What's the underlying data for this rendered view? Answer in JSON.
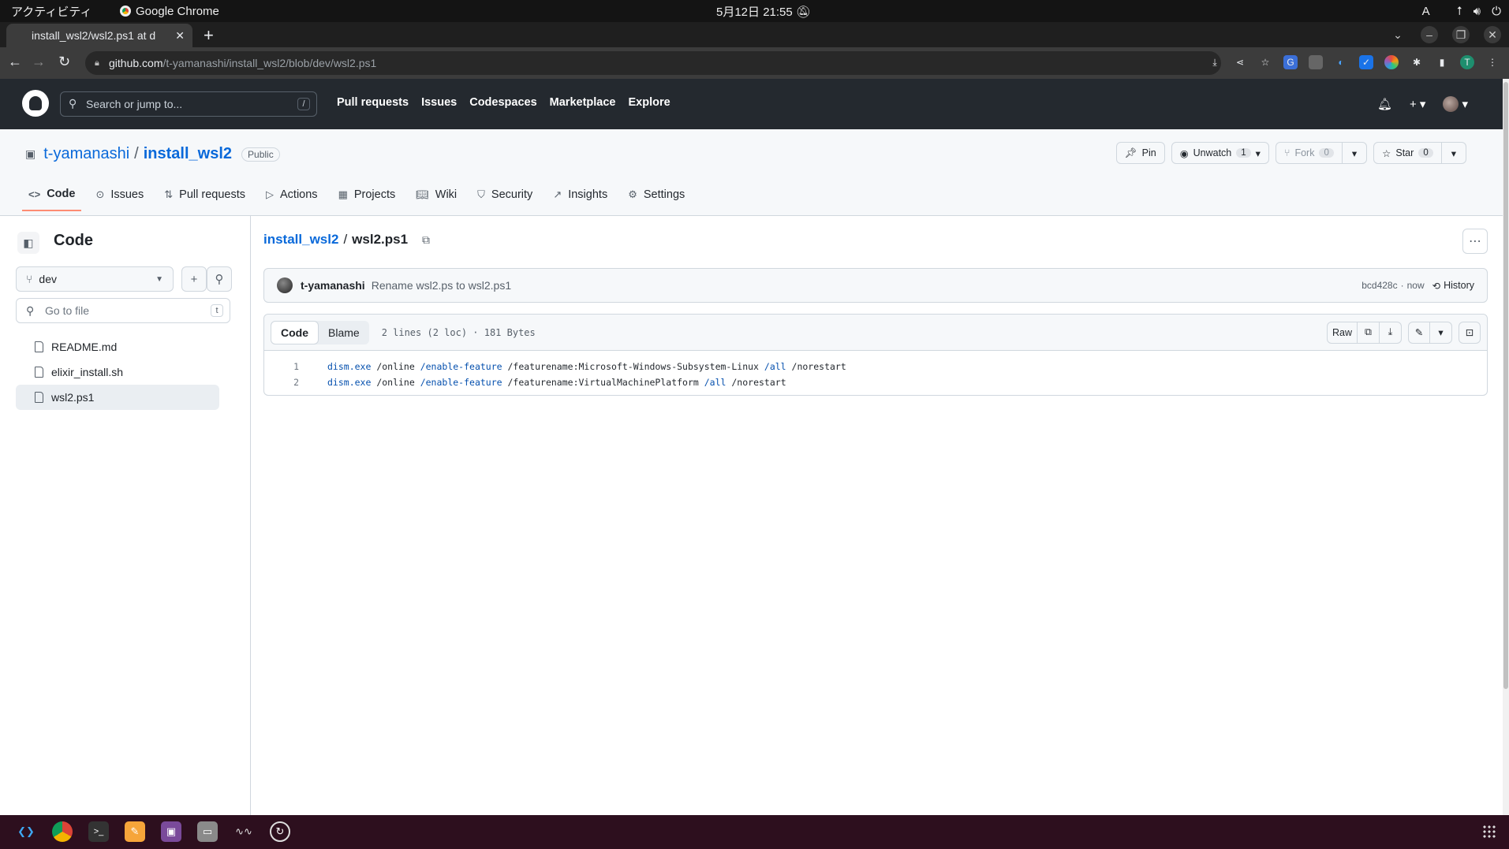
{
  "os": {
    "activities": "アクティビティ",
    "app_name": "Google Chrome",
    "clock": "5月12日  21:55",
    "input_method": "A"
  },
  "browser": {
    "tab_title": "install_wsl2/wsl2.ps1 at d",
    "url_host": "github.com",
    "url_path": "/t-yamanashi/install_wsl2/blob/dev/wsl2.ps1",
    "profile_initial": "T"
  },
  "github": {
    "search_placeholder": "Search or jump to...",
    "search_key": "/",
    "nav": [
      "Pull requests",
      "Issues",
      "Codespaces",
      "Marketplace",
      "Explore"
    ]
  },
  "repo": {
    "owner": "t-yamanashi",
    "name": "install_wsl2",
    "visibility": "Public",
    "pin_label": "Pin",
    "unwatch_label": "Unwatch",
    "unwatch_count": "1",
    "fork_label": "Fork",
    "fork_count": "0",
    "star_label": "Star",
    "star_count": "0",
    "tabs": [
      {
        "label": "Code",
        "icon": "code-icon"
      },
      {
        "label": "Issues",
        "icon": "issue-icon"
      },
      {
        "label": "Pull requests",
        "icon": "pull-request-icon"
      },
      {
        "label": "Actions",
        "icon": "play-icon"
      },
      {
        "label": "Projects",
        "icon": "table-icon"
      },
      {
        "label": "Wiki",
        "icon": "book-icon"
      },
      {
        "label": "Security",
        "icon": "shield-icon"
      },
      {
        "label": "Insights",
        "icon": "graph-icon"
      },
      {
        "label": "Settings",
        "icon": "gear-icon"
      }
    ]
  },
  "sidebar": {
    "title": "Code",
    "branch": "dev",
    "go_to_file_placeholder": "Go to file",
    "go_to_file_key": "t",
    "files": [
      "README.md",
      "elixir_install.sh",
      "wsl2.ps1"
    ]
  },
  "file": {
    "repo_crumb": "install_wsl2",
    "name": "wsl2.ps1",
    "commit_author": "t-yamanashi",
    "commit_message": "Rename wsl2.ps to wsl2.ps1",
    "commit_sha": "bcd428c",
    "commit_time": "now",
    "history_label": "History",
    "view_code": "Code",
    "view_blame": "Blame",
    "meta": "2 lines (2 loc) · 181 Bytes",
    "raw_label": "Raw",
    "lines": [
      {
        "num": "1",
        "cmd": "dism.exe",
        "a": " /online ",
        "b": "/enable-feature",
        "c": " /featurename:Microsoft-Windows-Subsystem-Linux ",
        "d": "/all",
        "e": " /norestart"
      },
      {
        "num": "2",
        "cmd": "dism.exe",
        "a": " /online ",
        "b": "/enable-feature",
        "c": " /featurename:VirtualMachinePlatform ",
        "d": "/all",
        "e": " /norestart"
      }
    ]
  }
}
